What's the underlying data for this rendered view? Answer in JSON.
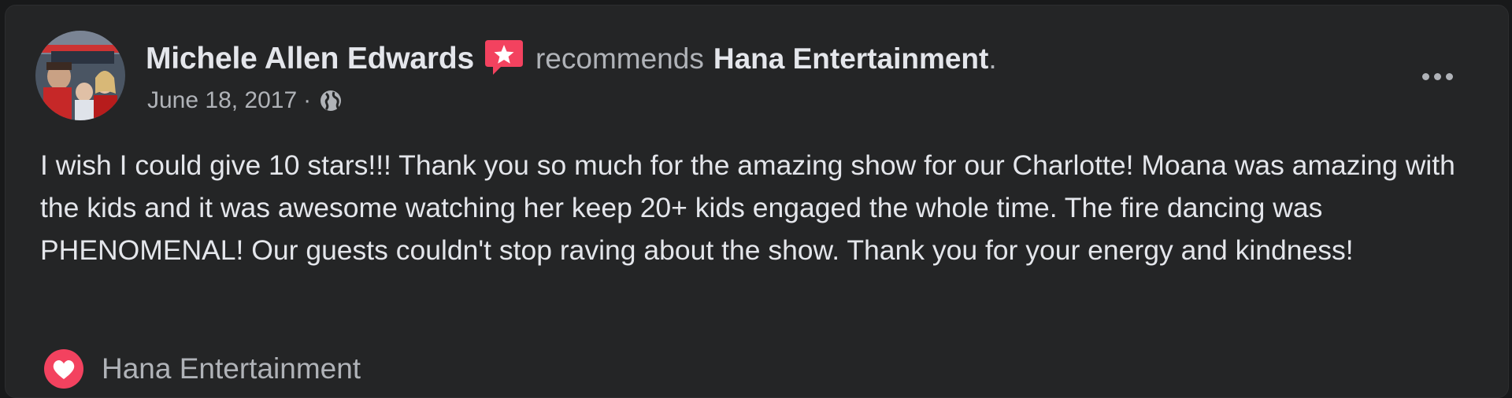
{
  "post": {
    "author": "Michele Allen Edwards",
    "action": "recommends",
    "page_name": "Hana Entertainment",
    "period": ".",
    "date": "June 18, 2017",
    "separator": "·",
    "privacy_icon": "globe-icon",
    "menu_icon": "more-options-icon",
    "body": "I wish I could give 10 stars!!! Thank you so much for the amazing show for our Charlotte! Moana was amazing with the kids and it was awesome watching her keep 20+ kids engaged the whole time. The fire dancing was PHENOMENAL! Our guests couldn't stop raving about the show. Thank you for your energy and kindness!"
  },
  "footer": {
    "reaction_icon": "heart-reaction-icon",
    "label": "Hana Entertainment"
  },
  "colors": {
    "background": "#18191a",
    "card": "#242526",
    "primary_text": "#e4e6eb",
    "secondary_text": "#b0b3b8",
    "recommend_badge": "#f3425f",
    "heart": "#f3425f"
  }
}
